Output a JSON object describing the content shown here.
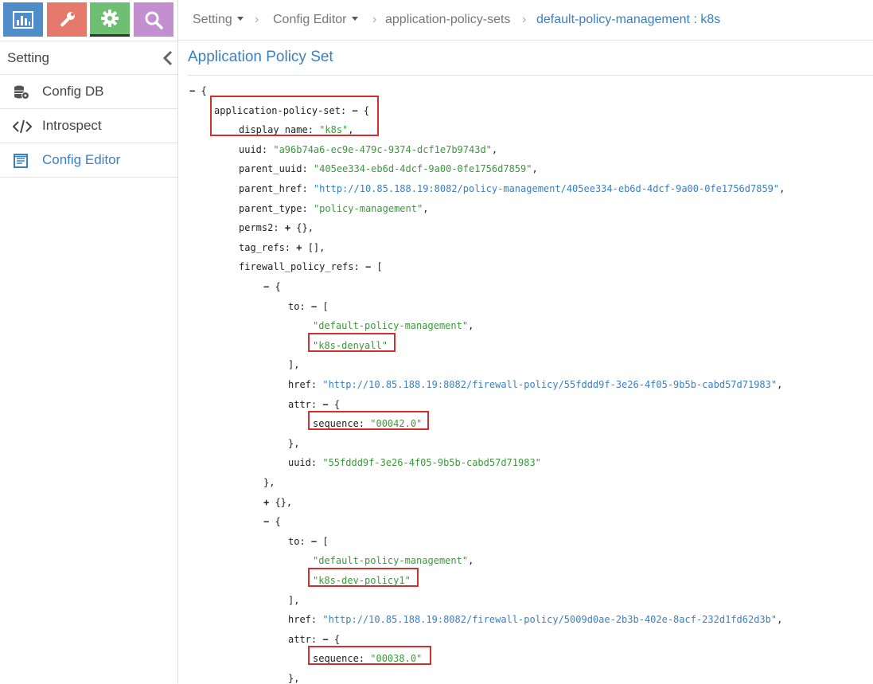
{
  "nav": {
    "icons": [
      {
        "name": "monitor-icon",
        "color": "#4f8dc9"
      },
      {
        "name": "configure-icon",
        "color": "#e57a6c"
      },
      {
        "name": "setting-icon",
        "color": "#6fbf73"
      },
      {
        "name": "query-icon",
        "color": "#c48fd0"
      }
    ],
    "active": "setting-icon"
  },
  "sidebar": {
    "title": "Setting",
    "items": [
      {
        "label": "Config DB",
        "icon": "database-gear-icon"
      },
      {
        "label": "Introspect",
        "icon": "code-icon"
      },
      {
        "label": "Config Editor",
        "icon": "editor-icon",
        "active": true
      }
    ]
  },
  "breadcrumb": {
    "items": [
      "Setting",
      "Config Editor",
      "application-policy-sets"
    ],
    "current": "default-policy-management : k8s"
  },
  "page": {
    "title": "Application Policy Set"
  },
  "json_view": {
    "lines": [
      {
        "toggle": "−",
        "punct": " {"
      },
      {
        "key": "application-policy-set",
        "toggle": "−",
        "punct": " {"
      },
      {
        "key": "display_name",
        "value": "\"k8s\"",
        "punct": ","
      },
      {
        "key": "uuid",
        "value": "\"a96b74a6-ec9e-479c-9374-dcf1e7b9743d\"",
        "punct": ","
      },
      {
        "key": "parent_uuid",
        "value": "\"405ee334-eb6d-4dcf-9a00-0fe1756d7859\"",
        "punct": ","
      },
      {
        "key": "parent_href",
        "link": "\"http://10.85.188.19:8082/policy-management/405ee334-eb6d-4dcf-9a00-0fe1756d7859\"",
        "punct": ","
      },
      {
        "key": "parent_type",
        "value": "\"policy-management\"",
        "punct": ","
      },
      {
        "key": "perms2",
        "toggle": "+",
        "punct": " {},"
      },
      {
        "key": "tag_refs",
        "toggle": "+",
        "punct": " [],"
      },
      {
        "key": "firewall_policy_refs",
        "toggle": "−",
        "punct": " ["
      },
      {
        "toggle": "−",
        "punct": " {"
      },
      {
        "key": "to",
        "toggle": "−",
        "punct": " ["
      },
      {
        "value": "\"default-policy-management\"",
        "punct": ","
      },
      {
        "value": "\"k8s-denyall\""
      },
      {
        "punct": "],"
      },
      {
        "key": "href",
        "link": "\"http://10.85.188.19:8082/firewall-policy/55fddd9f-3e26-4f05-9b5b-cabd57d71983\"",
        "punct": ","
      },
      {
        "key": "attr",
        "toggle": "−",
        "punct": " {"
      },
      {
        "key": "sequence",
        "value": "\"00042.0\""
      },
      {
        "punct": "},"
      },
      {
        "key": "uuid",
        "value": "\"55fddd9f-3e26-4f05-9b5b-cabd57d71983\""
      },
      {
        "punct": "},"
      },
      {
        "toggle": "+",
        "punct": " {},"
      },
      {
        "toggle": "−",
        "punct": " {"
      },
      {
        "key": "to",
        "toggle": "−",
        "punct": " ["
      },
      {
        "value": "\"default-policy-management\"",
        "punct": ","
      },
      {
        "value": "\"k8s-dev-policy1\""
      },
      {
        "punct": "],"
      },
      {
        "key": "href",
        "link": "\"http://10.85.188.19:8082/firewall-policy/5009d0ae-2b3b-402e-8acf-232d1fd62d3b\"",
        "punct": ","
      },
      {
        "key": "attr",
        "toggle": "−",
        "punct": " {"
      },
      {
        "key": "sequence",
        "value": "\"00038.0\""
      },
      {
        "punct": "},"
      }
    ]
  },
  "colors": {
    "accent": "#3b7fc4",
    "string": "#3a9a3a",
    "highlight": "#d22f2f"
  }
}
